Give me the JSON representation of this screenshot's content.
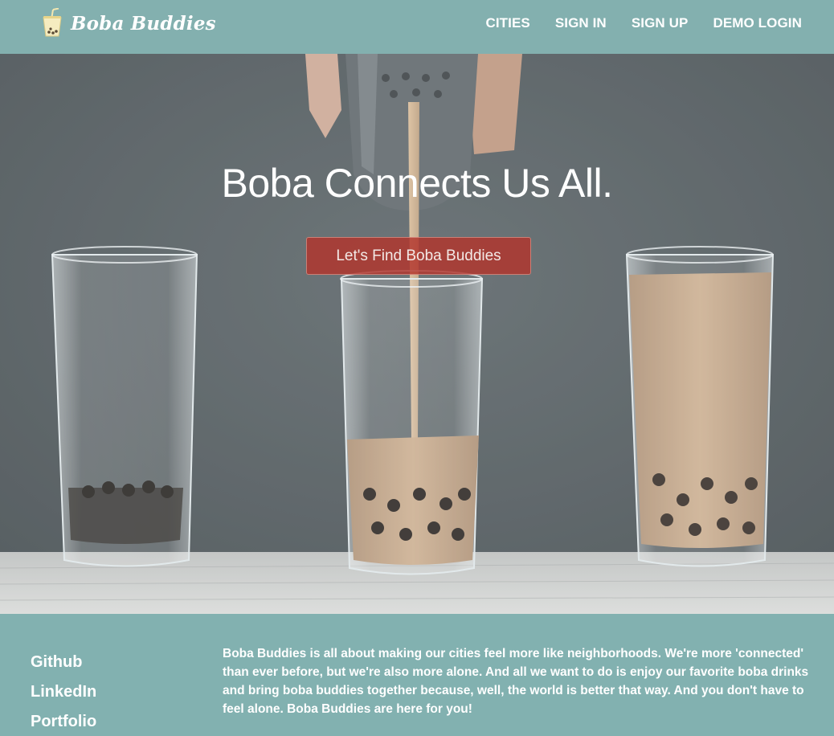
{
  "brand": {
    "name": "Boba Buddies",
    "logo_icon": "boba-cup-icon"
  },
  "nav": {
    "items": [
      {
        "label": "CITIES"
      },
      {
        "label": "SIGN IN"
      },
      {
        "label": "SIGN UP"
      },
      {
        "label": "DEMO LOGIN"
      }
    ]
  },
  "hero": {
    "title": "Boba Connects Us All.",
    "cta_label": "Let's Find Boba Buddies"
  },
  "footer": {
    "links": [
      {
        "label": "Github"
      },
      {
        "label": "LinkedIn"
      },
      {
        "label": "Portfolio"
      }
    ],
    "about": "Boba Buddies is all about making our cities feel more like neighborhoods. We're more 'connected' than ever before, but we're also more alone. And all we want to do is enjoy our favorite boba drinks and bring boba buddies together because, well, the world is better that way. And you don't have to feel alone. Boba Buddies are here for you!"
  },
  "colors": {
    "header_bg": "#83b0af",
    "footer_bg": "#82b1b0",
    "cta_bg": "#b2342c",
    "hero_bg": "#434d51"
  }
}
